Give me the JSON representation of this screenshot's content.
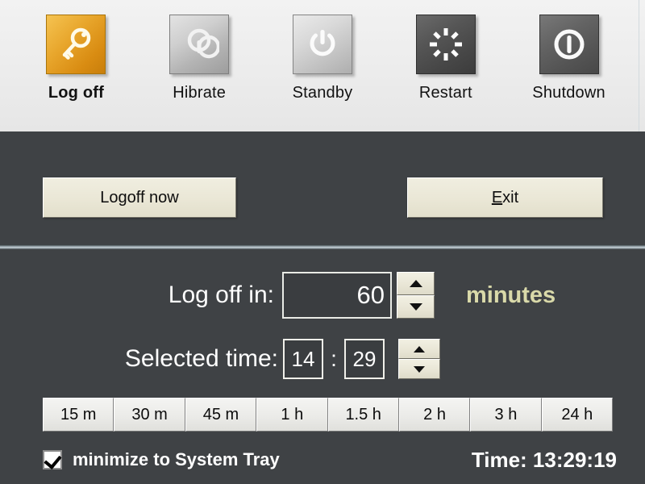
{
  "toolbar": {
    "items": [
      {
        "label": "Log off",
        "icon": "key-icon",
        "style": "gold",
        "active": true
      },
      {
        "label": "Hibrate",
        "icon": "hibernate-icon",
        "style": "silver",
        "active": false
      },
      {
        "label": "Standby",
        "icon": "power-standby-icon",
        "style": "silver-light",
        "active": false
      },
      {
        "label": "Restart",
        "icon": "restart-sun-icon",
        "style": "dark",
        "active": false
      },
      {
        "label": "Shutdown",
        "icon": "power-circle-icon",
        "style": "dark2",
        "active": false
      }
    ]
  },
  "actions": {
    "logoff_now_label": "Logoff now",
    "exit_label_accel": "E",
    "exit_label_rest": "xit"
  },
  "timer": {
    "logoff_in_label": "Log off in:",
    "logoff_in_value": "60",
    "minutes_label": "minutes",
    "selected_time_label": "Selected time:",
    "selected_hour": "14",
    "time_separator": ":",
    "selected_minute": "29",
    "spin_up_icon": "triangle-up-icon",
    "spin_down_icon": "triangle-down-icon"
  },
  "presets": [
    {
      "label": "15 m"
    },
    {
      "label": "30 m"
    },
    {
      "label": "45 m"
    },
    {
      "label": "1 h"
    },
    {
      "label": "1.5 h"
    },
    {
      "label": "2 h"
    },
    {
      "label": "3 h"
    },
    {
      "label": "24 h"
    }
  ],
  "footer": {
    "minimize_label": "minimize to System Tray",
    "minimize_checked": true,
    "checkbox_icon": "checkmark-icon",
    "clock_text": "Time: 13:29:19"
  },
  "colors": {
    "panel_bg": "#3f4245",
    "toolbar_bg": "#ececec",
    "accent_gold": "#e8a62c",
    "minutes_text": "#d9d9a9",
    "button_face": "#eae7d6",
    "text_light": "#ffffff"
  }
}
